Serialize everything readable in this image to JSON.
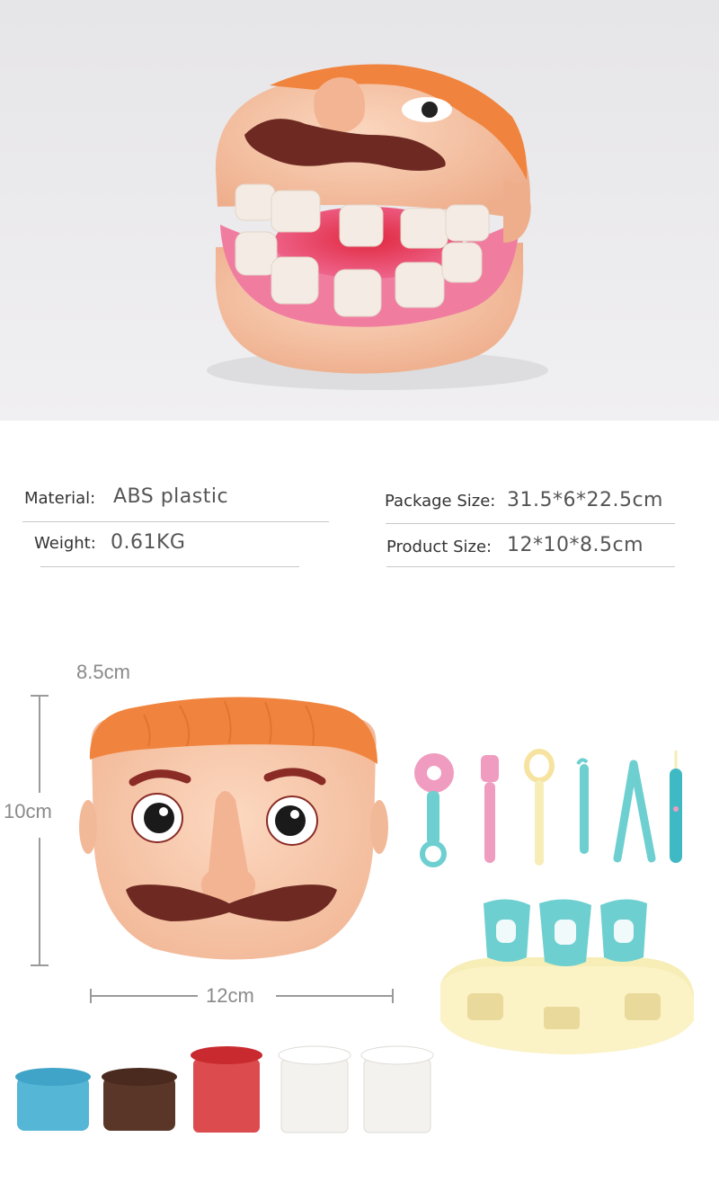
{
  "specs": {
    "material": {
      "label": "Material:",
      "value": "ABS plastic"
    },
    "weight": {
      "label": "Weight:",
      "value": "0.61KG"
    },
    "package_size": {
      "label": "Package Size:",
      "value": "31.5*6*22.5cm"
    },
    "product_size": {
      "label": "Product Size:",
      "value": "12*10*8.5cm"
    }
  },
  "dimensions": {
    "depth": "8.5cm",
    "height": "10cm",
    "width": "12cm"
  },
  "colors": {
    "skin": "#f6c2a3",
    "hair": "#f0843e",
    "gum": "#f07da0",
    "mustache": "#6e2a22",
    "teal": "#6ecfd0",
    "pink": "#f09cc0",
    "cream": "#f7edb6",
    "dough_colors": [
      "#56b6d6",
      "#5a3628",
      "#d8393c",
      "#f4f2ee",
      "#f4f2ee"
    ]
  }
}
